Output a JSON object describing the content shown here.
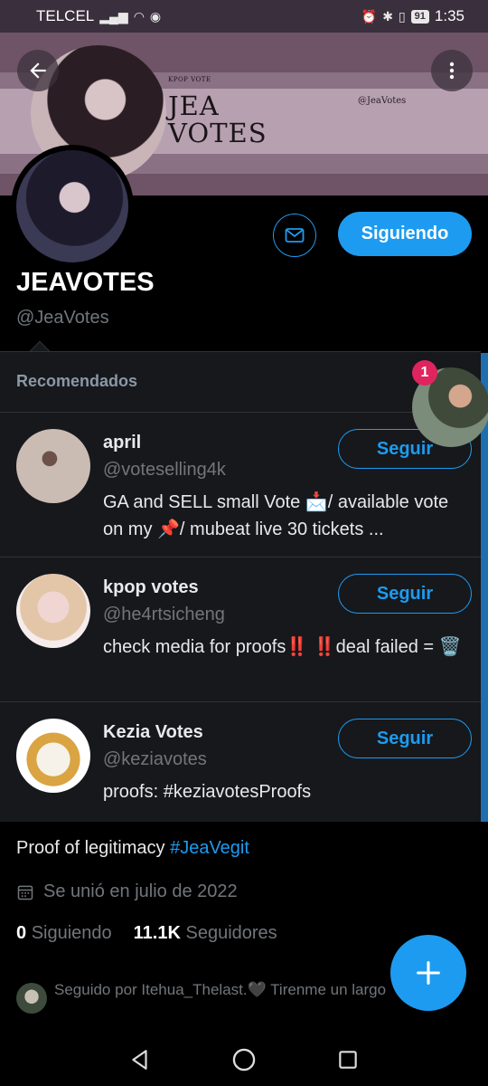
{
  "status_bar": {
    "carrier": "TELCEL",
    "battery": "91",
    "time": "1:35"
  },
  "banner": {
    "small_caption": "KPOP VOTE",
    "title_line1": "JEA",
    "title_line2": "VOTES",
    "handle": "@JeaVotes"
  },
  "profile": {
    "name": "JEAVOTES",
    "handle": "@JeaVotes",
    "follow_label": "Siguiendo"
  },
  "recommendations": {
    "header": "Recomendados",
    "items": [
      {
        "name": "april",
        "handle": "@voteselling4k",
        "bio": "GA and SELL small Vote 📩/ available vote on my 📌/ mubeat live 30 tickets ...",
        "button": "Seguir",
        "avatar_color": "#cbbcb3"
      },
      {
        "name": "kpop votes",
        "handle": "@he4rtsicheng",
        "bio": "check media for proofs‼️ ‼️deal failed = 🗑️",
        "button": "Seguir",
        "avatar_color": "#e8d4d4"
      },
      {
        "name": "Kezia Votes",
        "handle": "@keziavotes",
        "bio": "proofs: #keziavotesProofs",
        "button": "Seguir",
        "avatar_color": "#f4f4f4"
      }
    ]
  },
  "chat_head": {
    "badge": "1"
  },
  "bio": {
    "text": "Proof of legitimacy ",
    "hashtag": "#JeaVegit"
  },
  "joined": "Se unió en julio de 2022",
  "stats": {
    "following_count": "0",
    "following_label": "Siguiendo",
    "followers_count": "11.1K",
    "followers_label": "Seguidores"
  },
  "followed_by": "Seguido por Itehua_Thelast.🖤 Tirenme un largo",
  "colors": {
    "accent": "#1d9bf0",
    "background": "#000000",
    "panel": "#16181c"
  }
}
